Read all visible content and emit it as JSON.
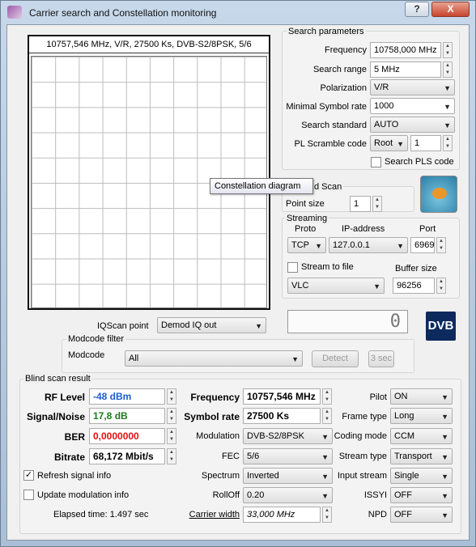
{
  "window": {
    "title": "Carrier search and Constellation monitoring",
    "help_label": "?",
    "close_label": "X"
  },
  "plot": {
    "header": "10757,546 MHz, V/R, 27500 Ks, DVB-S2/8PSK, 5/6",
    "tooltip": "Constellation diagram"
  },
  "search": {
    "group_label": "Search parameters",
    "frequency_label": "Frequency",
    "frequency_value": "10758,000 MHz",
    "range_label": "Search range",
    "range_value": "5 MHz",
    "polarization_label": "Polarization",
    "polarization_value": "V/R",
    "min_sr_label": "Minimal Symbol rate",
    "min_sr_value": "1000",
    "standard_label": "Search standard",
    "standard_value": "AUTO",
    "pls_label": "PL Scramble code",
    "pls_mode": "Root",
    "pls_value": "1",
    "search_pls_label": "Search PLS code"
  },
  "iqscan": {
    "group_label": "d Scan",
    "point_size_label": "Point size",
    "point_size_value": "1"
  },
  "streaming": {
    "group_label": "Streaming",
    "proto_label": "Proto",
    "ip_label": "IP-address",
    "port_label": "Port",
    "proto_value": "TCP",
    "ip_value": "127.0.0.1",
    "port_value": "6969",
    "stream_file_label": "Stream to file",
    "buffer_label": "Buffer size",
    "player_value": "VLC",
    "buffer_value": "96256"
  },
  "iq_point": {
    "label": "IQScan point",
    "value": "Demod IQ out"
  },
  "modcode": {
    "group_label": "Modcode filter",
    "label": "Modcode",
    "value": "All",
    "detect_label": "Detect",
    "timeout_value": "3 sec"
  },
  "lcd_value": "0",
  "logo_text": "DVB",
  "result": {
    "group_label": "Blind scan result",
    "rf_label": "RF Level",
    "rf_value": "-48 dBm",
    "sn_label": "Signal/Noise",
    "sn_value": "17,8 dB",
    "ber_label": "BER",
    "ber_value": "0,0000000",
    "bitrate_label": "Bitrate",
    "bitrate_value": "68,172 Mbit/s",
    "freq_label": "Frequency",
    "freq_value": "10757,546 MHz",
    "sr_label": "Symbol rate",
    "sr_value": "27500 Ks",
    "modulation_label": "Modulation",
    "modulation_value": "DVB-S2/8PSK",
    "fec_label": "FEC",
    "fec_value": "5/6",
    "spectrum_label": "Spectrum",
    "spectrum_value": "Inverted",
    "rolloff_label": "RollOff",
    "rolloff_value": "0.20",
    "carrier_width_label": "Carrier width",
    "carrier_width_value": "33,000 MHz",
    "pilot_label": "Pilot",
    "pilot_value": "ON",
    "frame_label": "Frame type",
    "frame_value": "Long",
    "coding_label": "Coding mode",
    "coding_value": "CCM",
    "stream_type_label": "Stream type",
    "stream_type_value": "Transport",
    "input_stream_label": "Input stream",
    "input_stream_value": "Single",
    "issyi_label": "ISSYI",
    "issyi_value": "OFF",
    "npd_label": "NPD",
    "npd_value": "OFF",
    "refresh_label": "Refresh signal info",
    "update_label": "Update modulation info",
    "elapsed": "Elapsed time: 1.497 sec"
  },
  "colors": {
    "rf": "#1a5fd0",
    "sn": "#1c7a1c",
    "ber": "#e01010"
  }
}
